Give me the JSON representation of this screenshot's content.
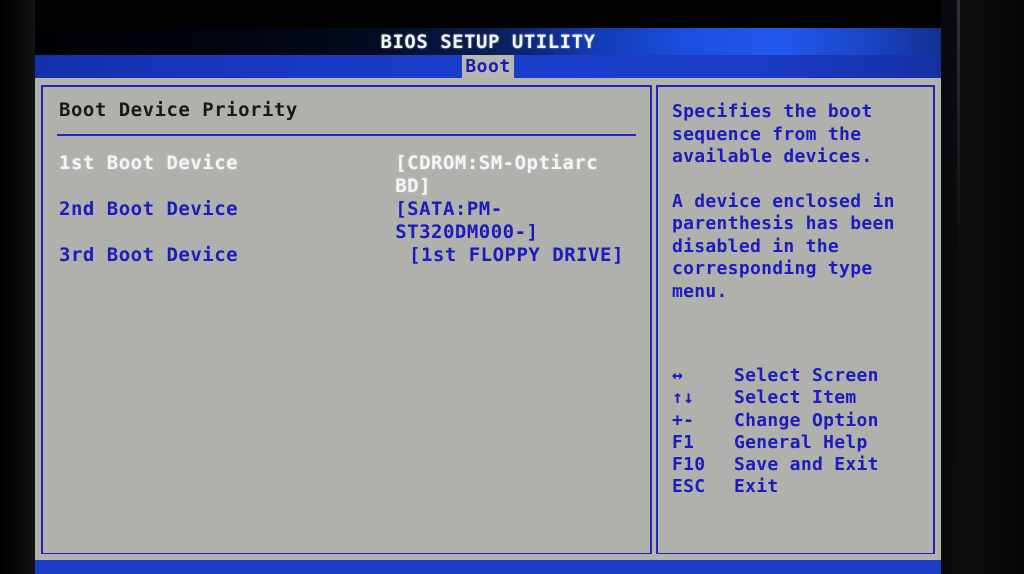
{
  "window": {
    "title": "BIOS SETUP UTILITY"
  },
  "menu": {
    "tabs": [
      {
        "label": "Boot",
        "active": true
      }
    ]
  },
  "main_panel": {
    "section_title": "Boot Device Priority",
    "rows": [
      {
        "label": "1st Boot Device",
        "value": "[CDROM:SM-Optiarc BD]",
        "selected": true
      },
      {
        "label": "2nd Boot Device",
        "value": "[SATA:PM-ST320DM000-]",
        "selected": false
      },
      {
        "label": "3rd Boot Device",
        "value": "[1st FLOPPY DRIVE]",
        "selected": false
      }
    ]
  },
  "help_panel": {
    "paragraph1": "Specifies the boot\nsequence from the\navailable devices.",
    "paragraph2": "A device enclosed in\nparenthesis has been\ndisabled in the\ncorresponding type\nmenu.",
    "keys": [
      {
        "key": "↔",
        "desc": "Select Screen"
      },
      {
        "key": "↑↓",
        "desc": "Select Item"
      },
      {
        "key": "+-",
        "desc": "Change Option"
      },
      {
        "key": "F1",
        "desc": "General Help"
      },
      {
        "key": "F10",
        "desc": "Save and Exit"
      },
      {
        "key": "ESC",
        "desc": "Exit"
      }
    ]
  },
  "footer": {
    "text": ""
  },
  "colors": {
    "accent_blue": "#1c1cbe",
    "panel_bg": "#b0b0ac",
    "titlebar_blue": "#1b3ecb",
    "selected_text": "#f4f5f7",
    "heading_text": "#18181a"
  }
}
